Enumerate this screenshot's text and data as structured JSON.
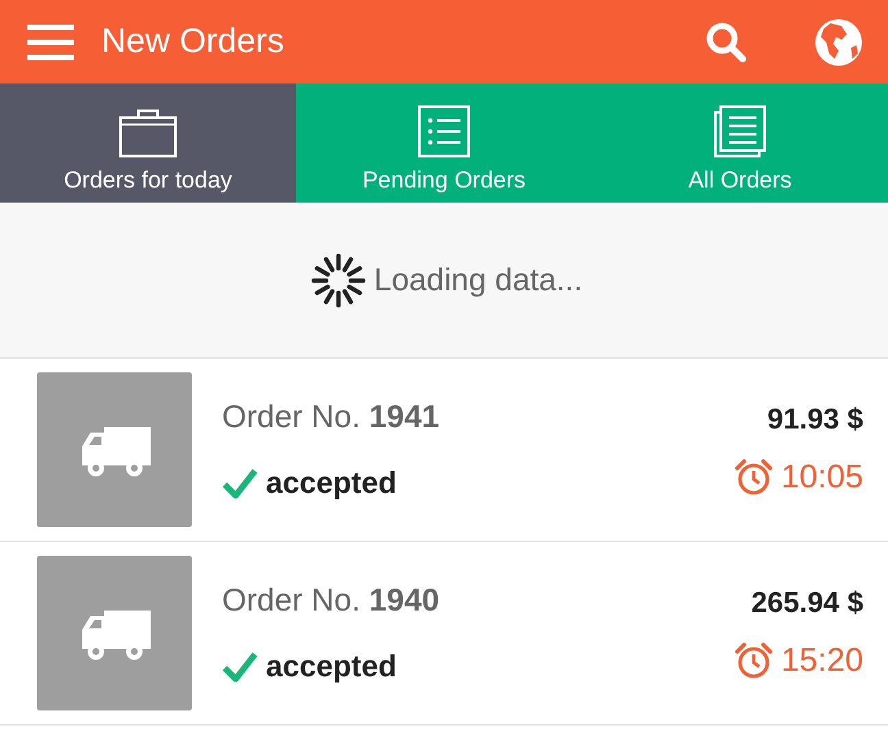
{
  "app_bar": {
    "title": "New Orders"
  },
  "tabs": [
    {
      "label": "Orders for today",
      "kind": "briefcase",
      "selected": true
    },
    {
      "label": "Pending Orders",
      "kind": "list",
      "selected": false
    },
    {
      "label": "All Orders",
      "kind": "documents",
      "selected": false
    }
  ],
  "loading": {
    "text": "Loading data..."
  },
  "orders": [
    {
      "title": "Order No. **1941**",
      "status": {
        "kind": "accepted",
        "label": "accepted"
      },
      "price": "91.93 $",
      "time": "10:05"
    },
    {
      "title": "Order No. **1940**",
      "status": {
        "kind": "accepted",
        "label": "accepted"
      },
      "price": "265.94 $",
      "time": "15:20"
    }
  ]
}
